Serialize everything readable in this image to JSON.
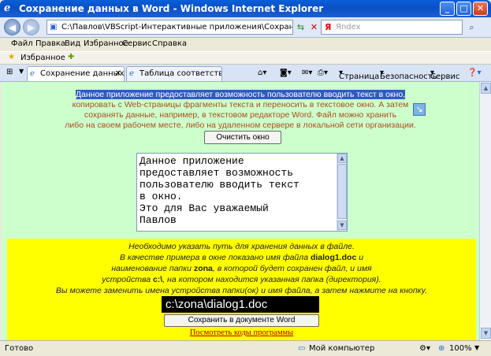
{
  "window": {
    "title": "Сохранение данных в Word - Windows Internet Explorer",
    "icon": "ie-icon",
    "buttons": [
      "minimize",
      "maximize",
      "close"
    ]
  },
  "address": {
    "url": "C:\\Павлов\\VBScript-Интерактивные приложения\\Сохранение данных в Word.ht",
    "search_placeholder": "Яndex",
    "search_logo": "Я"
  },
  "menu": [
    "Файл",
    "Правка",
    "Вид",
    "Избранное",
    "Сервис",
    "Справка"
  ],
  "favorites": {
    "label": "Избранное"
  },
  "tabs": [
    {
      "label": "Сохранение данных в ...",
      "active": true
    },
    {
      "label": "Таблица соответствия цве...",
      "active": false
    }
  ],
  "toolbar": {
    "page": "Страница",
    "safety": "Безопасность",
    "tools": "Сервис"
  },
  "content": {
    "intro_highlight": "Данное приложение предоставляет возможность пользователю вводить текст в окно,",
    "intro_lines": [
      "копировать с Web-страницы фрагменты текста и переносить в текстовое окно. А затем",
      "сохранять данные, например, в текстовом редакторе Word. Файл можно хранить",
      "либо на своем рабочем месте, либо на удаленном сервере в локальной сети организации."
    ],
    "clear_button": "Очистить окно",
    "textarea_text": "Данное приложение\nпредоставляет возможность\nпользователю вводить текст\nв окно.\nЭто для Вас уважаемый\nПавлов",
    "info": {
      "line1": "Необходимо указать путь для хранения данных в файле.",
      "line2_pre": "В качестве примера в окне показано имя файла ",
      "line2_file": "dialog1.doc",
      "line2_post": " и",
      "line3_pre": "наименование папки ",
      "line3_folder": "zona",
      "line3_post": ", в которой будет сохранен файл, и имя",
      "line4_pre": "устройства ",
      "line4_device": "c:\\",
      "line4_post": ", на котором находится указанная папка (директория).",
      "line5": "Вы можете заменить имена устройства папки(ок) и имя файла, а затем нажмите на кнопку."
    },
    "path_value": "c:\\zona\\dialog1.doc",
    "save_button": "Сохранить в документе Word",
    "code_link": "Посмотреть коды программы"
  },
  "status": {
    "left": "Готово",
    "zone": "Мой компьютер",
    "zoom": "100%"
  },
  "colors": {
    "content_bg": "#ccffcc",
    "info_bg": "#ffff00",
    "highlight": "#2f5bbf",
    "intro_text": "#b04a1c"
  }
}
